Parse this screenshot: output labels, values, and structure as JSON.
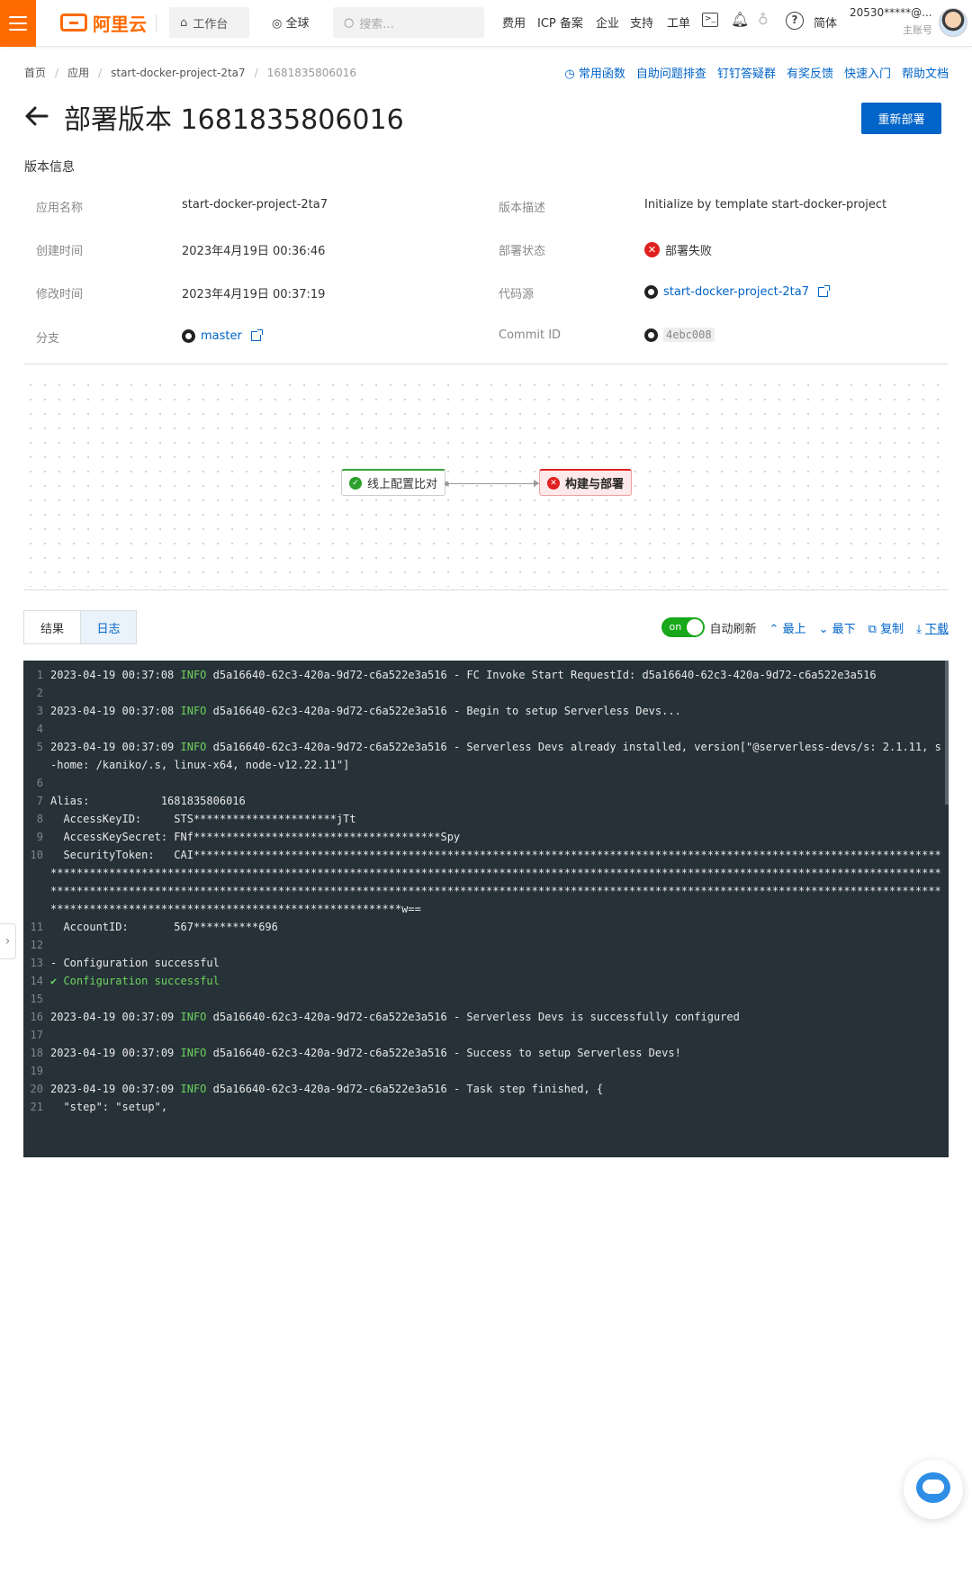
{
  "topbar": {
    "logo_text": "阿里云",
    "workbench": "工作台",
    "region": "全球",
    "search_placeholder": "搜索...",
    "nav": [
      "费用",
      "ICP 备案",
      "企业",
      "支持",
      "工单"
    ],
    "lang": "简体",
    "account_name": "20530*****@...",
    "account_type": "主账号"
  },
  "breadcrumb": [
    "首页",
    "应用",
    "start-docker-project-2ta7",
    "1681835806016"
  ],
  "help_links": [
    "常用函数",
    "自助问题排查",
    "钉钉答疑群",
    "有奖反馈",
    "快速入门",
    "帮助文档"
  ],
  "page": {
    "title": "部署版本 1681835806016",
    "redeploy_label": "重新部署"
  },
  "info": {
    "section_title": "版本信息",
    "app_name_label": "应用名称",
    "app_name": "start-docker-project-2ta7",
    "desc_label": "版本描述",
    "desc": "Initialize by template start-docker-project",
    "created_label": "创建时间",
    "created": "2023年4月19日 00:36:46",
    "status_label": "部署状态",
    "status": "部署失败",
    "status_color": "#e02020",
    "modified_label": "修改时间",
    "modified": "2023年4月19日 00:37:19",
    "source_label": "代码源",
    "source": "start-docker-project-2ta7",
    "branch_label": "分支",
    "branch": "master",
    "commit_label": "Commit ID",
    "commit": "4ebc008"
  },
  "pipeline": {
    "step1": "线上配置比对",
    "step1_status": "success",
    "step2": "构建与部署",
    "step2_status": "failed"
  },
  "tabs": [
    "结果",
    "日志"
  ],
  "active_tab": "日志",
  "toolbar": {
    "toggle": "on",
    "auto_refresh": "自动刷新",
    "top": "最上",
    "bottom": "最下",
    "copy": "复制",
    "download": "下载"
  },
  "log_lines": [
    {
      "n": "1",
      "pre": "2023-04-19 00:37:08 ",
      "lvl": "INFO",
      "post": " d5a16640-62c3-420a-9d72-c6a522e3a516 - FC Invoke Start RequestId: d5a16640-62c3-420a-9d72-c6a522e3a516"
    },
    {
      "n": "2",
      "pre": "",
      "lvl": "",
      "post": ""
    },
    {
      "n": "3",
      "pre": "2023-04-19 00:37:08 ",
      "lvl": "INFO",
      "post": " d5a16640-62c3-420a-9d72-c6a522e3a516 - Begin to setup Serverless Devs..."
    },
    {
      "n": "4",
      "pre": "",
      "lvl": "",
      "post": ""
    },
    {
      "n": "5",
      "pre": "2023-04-19 00:37:09 ",
      "lvl": "INFO",
      "post": " d5a16640-62c3-420a-9d72-c6a522e3a516 - Serverless Devs already installed, version[\"@serverless-devs/s: 2.1.11, s-home: /kaniko/.s, linux-x64, node-v12.22.11\"]"
    },
    {
      "n": "6",
      "pre": "",
      "lvl": "",
      "post": ""
    },
    {
      "n": "7",
      "pre": "Alias:           1681835806016",
      "lvl": "",
      "post": ""
    },
    {
      "n": "8",
      "pre": "  AccessKeyID:     STS**********************jTt",
      "lvl": "",
      "post": ""
    },
    {
      "n": "9",
      "pre": "  AccessKeySecret: FNf**************************************Spy",
      "lvl": "",
      "post": ""
    },
    {
      "n": "10",
      "pre": "  SecurityToken:   CAI***********************************************************************************************************************************************************************************************************************************************************************************************************************************************************************************************************************************************************w==",
      "lvl": "",
      "post": ""
    },
    {
      "n": "11",
      "pre": "  AccountID:       567**********696",
      "lvl": "",
      "post": ""
    },
    {
      "n": "12",
      "pre": "",
      "lvl": "",
      "post": ""
    },
    {
      "n": "13",
      "pre": "- Configuration successful",
      "lvl": "",
      "post": ""
    },
    {
      "n": "14",
      "pre": "✔ Configuration successful",
      "lvl": "",
      "post": ""
    },
    {
      "n": "15",
      "pre": "",
      "lvl": "",
      "post": ""
    },
    {
      "n": "16",
      "pre": "2023-04-19 00:37:09 ",
      "lvl": "INFO",
      "post": " d5a16640-62c3-420a-9d72-c6a522e3a516 - Serverless Devs is successfully configured"
    },
    {
      "n": "17",
      "pre": "",
      "lvl": "",
      "post": ""
    },
    {
      "n": "18",
      "pre": "2023-04-19 00:37:09 ",
      "lvl": "INFO",
      "post": " d5a16640-62c3-420a-9d72-c6a522e3a516 - Success to setup Serverless Devs!"
    },
    {
      "n": "19",
      "pre": "",
      "lvl": "",
      "post": ""
    },
    {
      "n": "20",
      "pre": "2023-04-19 00:37:09 ",
      "lvl": "INFO",
      "post": " d5a16640-62c3-420a-9d72-c6a522e3a516 - Task step finished, {"
    },
    {
      "n": "21",
      "pre": "  \"step\": \"setup\",",
      "lvl": "",
      "post": ""
    }
  ]
}
